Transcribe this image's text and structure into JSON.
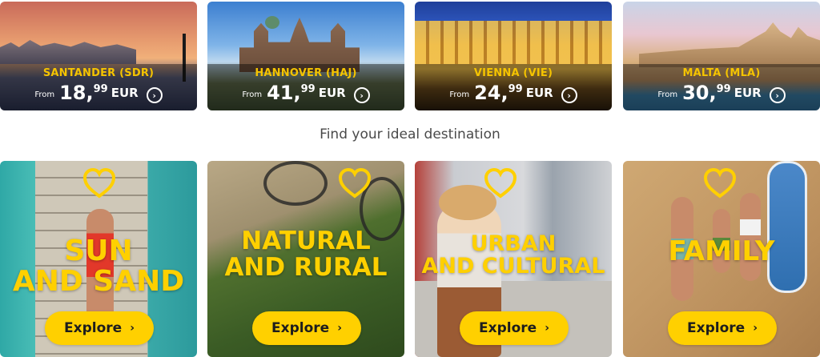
{
  "destinations": [
    {
      "city": "SANTANDER (SDR)",
      "from": "From",
      "price_int": "18,",
      "price_dec": "99",
      "currency": "EUR",
      "arrow": "›",
      "icon": "chevron-right-circle-icon"
    },
    {
      "city": "HANNOVER (HAJ)",
      "from": "From",
      "price_int": "41,",
      "price_dec": "99",
      "currency": "EUR",
      "arrow": "›",
      "icon": "chevron-right-circle-icon"
    },
    {
      "city": "VIENNA (VIE)",
      "from": "From",
      "price_int": "24,",
      "price_dec": "99",
      "currency": "EUR",
      "arrow": "›",
      "icon": "chevron-right-circle-icon"
    },
    {
      "city": "MALTA (MLA)",
      "from": "From",
      "price_int": "30,",
      "price_dec": "99",
      "currency": "EUR",
      "arrow": "›",
      "icon": "chevron-right-circle-icon"
    }
  ],
  "section_heading": "Find your ideal destination",
  "categories": [
    {
      "line1": "SUN",
      "line2": "AND SAND",
      "explore": "Explore",
      "chevron": "›",
      "icon": "heart-icon"
    },
    {
      "line1": "NATURAL",
      "line2": "AND RURAL",
      "explore": "Explore",
      "chevron": "›",
      "icon": "heart-icon"
    },
    {
      "line1": "URBAN",
      "line2": "AND CULTURAL",
      "explore": "Explore",
      "chevron": "›",
      "icon": "heart-icon"
    },
    {
      "line1": "FAMILY",
      "line2": "",
      "explore": "Explore",
      "chevron": "›",
      "icon": "heart-icon"
    }
  ],
  "colors": {
    "accent_yellow": "#ffd000",
    "city_yellow": "#f5c400",
    "text_dark": "#1d1d1d",
    "heading_gray": "#4a4a4a"
  }
}
